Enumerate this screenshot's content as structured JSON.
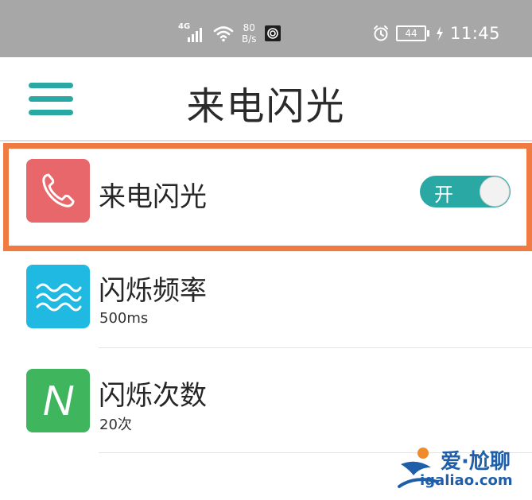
{
  "status_bar": {
    "network_type": "4G",
    "speed_value": "80",
    "speed_unit": "B/s",
    "battery_level": "44",
    "time": "11:45",
    "icons": [
      "signal-icon",
      "wifi-icon",
      "app-icon",
      "alarm-icon",
      "battery-icon",
      "charging-icon"
    ]
  },
  "header": {
    "menu_icon": "hamburger-menu-icon",
    "title": "来电闪光"
  },
  "rows": [
    {
      "title": "来电闪光",
      "icon": "phone-icon",
      "icon_color": "#e8676a",
      "toggle_label": "开",
      "toggle_on": true
    },
    {
      "title": "闪烁频率",
      "subtitle": "500ms",
      "icon": "wave-icon",
      "icon_color": "#1fb9e1"
    },
    {
      "title": "闪烁次数",
      "subtitle": "20次",
      "icon": "letter-n-icon",
      "icon_glyph": "N",
      "icon_color": "#3fb55d"
    }
  ],
  "watermark": {
    "name": "爱·尬聊",
    "url": "igaliao.com"
  },
  "colors": {
    "accent": "#2aa8a3",
    "highlight": "#ef7b43",
    "status_bar": "#a7a7a7"
  }
}
